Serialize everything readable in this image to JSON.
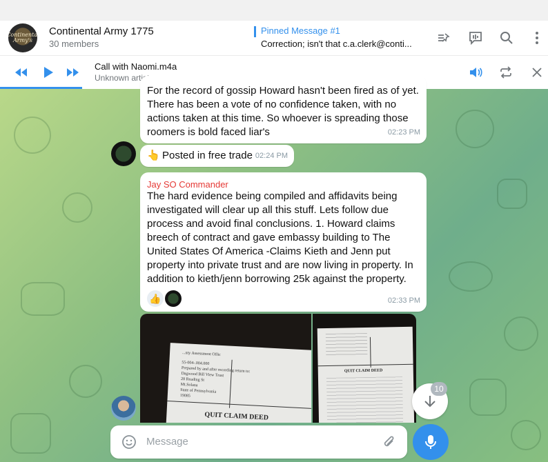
{
  "header": {
    "title": "Continental Army 1775",
    "members": "30 members",
    "avatar_text": "Continental Army's",
    "pinned_label": "Pinned Message #1",
    "pinned_text": "Correction; isn't that c.a.clerk@conti..."
  },
  "header_icons": [
    "pinned-list-icon",
    "live-stream-icon",
    "search-icon",
    "more-vertical-icon"
  ],
  "player": {
    "title": "Call with Naomi.m4a",
    "subtitle": "Unknown artist",
    "progress_fraction": 0.15
  },
  "player_icons": [
    "rewind-icon",
    "play-icon",
    "fast-forward-icon",
    "volume-icon",
    "repeat-icon",
    "close-icon"
  ],
  "messages": [
    {
      "text": "For the record of gossip Howard hasn't been fired as of yet. There has been a vote of no confidence taken, with no actions taken at this time. So whoever is spreading those roomers is bold faced liar's",
      "time": "02:23 PM"
    },
    {
      "emoji": "👆",
      "text": "Posted in free trade",
      "time": "02:24 PM"
    },
    {
      "sender": "Jay SO Commander",
      "text": "The hard evidence being compiled and affidavits being investigated will clear up all this stuff. Lets follow due process and avoid final conclusions. 1. Howard claims breech of contract and gave embassy building to The United States Of America -Claims Kieth and Jenn put property into private trust and are now living in property. In addition to kieth/jenn borrowing 25k against the property.",
      "reaction_emoji": "👍",
      "time": "02:33 PM"
    }
  ],
  "photos": {
    "left_heading": "QUIT CLAIM DEED",
    "left_lines": [
      "...nty Assessment Offic",
      "55-004-.004.000",
      "Prepared by and after recording return to:",
      "Dagwood Bill View Trust",
      "28 Reading St",
      "Mt.Solana",
      "State of Pennsylvania",
      "19085"
    ],
    "right_heading": "QUIT CLAIM DEED"
  },
  "scroll_badge": "10",
  "input": {
    "placeholder": "Message"
  },
  "colors": {
    "accent": "#3390ec",
    "sender": "#e53935",
    "chat_bg": "#8fc082"
  }
}
